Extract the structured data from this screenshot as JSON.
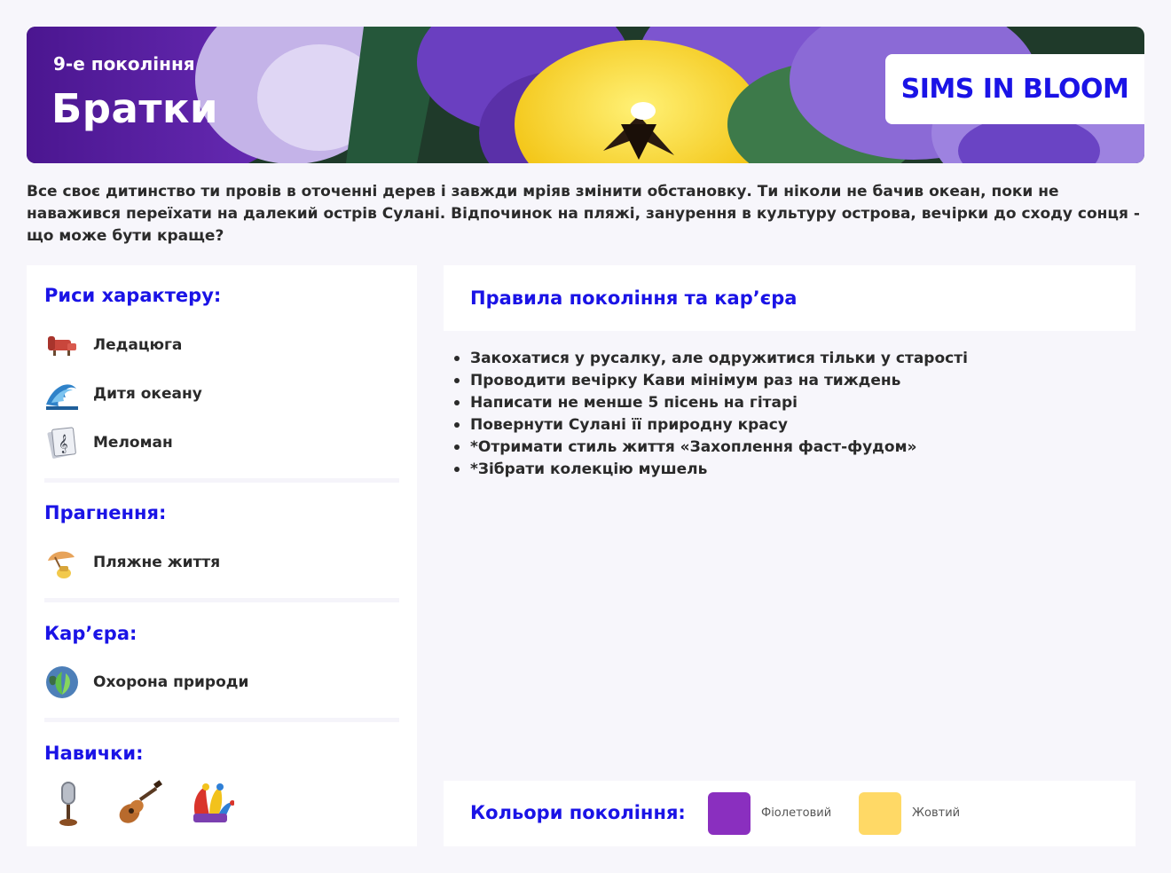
{
  "banner": {
    "generation_label": "9-е покоління",
    "title": "Братки",
    "brand": "SIMS IN BLOOM"
  },
  "intro": "Все своє дитинство ти провів в оточенні дерев і завжди мріяв змінити обстановку. Ти ніколи не бачив океан, поки не наважився переїхати на далекий острів Сулані. Відпочинок на пляжі, занурення в культуру острова, вечірки до сходу сонця - що може бути краще?",
  "traits": {
    "title": "Риси характеру:",
    "items": [
      {
        "label": "Ледацюга",
        "icon": "recliner-icon"
      },
      {
        "label": "Дитя океану",
        "icon": "wave-icon"
      },
      {
        "label": "Меломан",
        "icon": "sheet-music-icon"
      }
    ]
  },
  "aspiration": {
    "title": "Прагнення:",
    "items": [
      {
        "label": "Пляжне життя",
        "icon": "beach-umbrella-icon"
      }
    ]
  },
  "career": {
    "title": "Кар’єра:",
    "items": [
      {
        "label": "Охорона природи",
        "icon": "leaf-globe-icon"
      }
    ]
  },
  "skills": {
    "title": "Навички:",
    "icons": [
      "microphone-icon",
      "guitar-icon",
      "jester-hat-icon"
    ]
  },
  "rules": {
    "title": "Правила покоління та кар’єра",
    "items": [
      "Закохатися у русалку, але одружитися тільки у старості",
      "Проводити вечірку Кави мінімум раз на тиждень",
      "Написати не менше 5 пісень на гітарі",
      "Повернути Сулані її природну красу",
      "*Отримати стиль життя «Захоплення фаст-фудом»",
      "*Зібрати колекцію мушель"
    ]
  },
  "colors": {
    "title": "Кольори покоління:",
    "swatches": [
      {
        "name": "Фіолетовий",
        "hex": "#8a2fbf"
      },
      {
        "name": "Жовтий",
        "hex": "#ffd966"
      }
    ]
  },
  "theme": {
    "accent": "#1a13e6",
    "card": "#ffffff",
    "background": "#f7f6fb"
  }
}
